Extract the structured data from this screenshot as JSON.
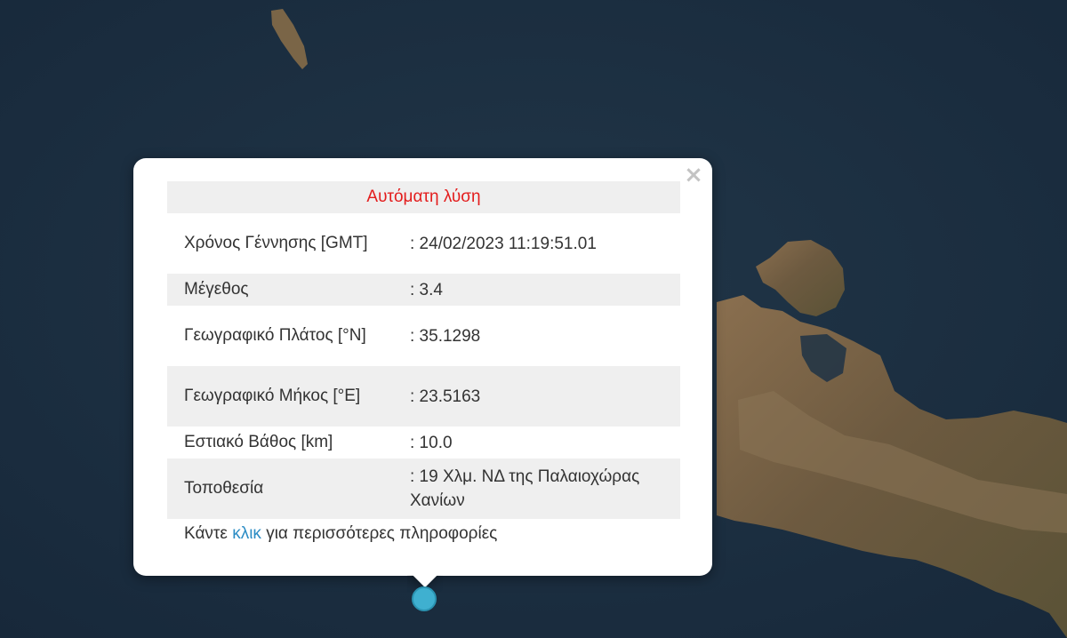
{
  "popup": {
    "title": "Αυτόματη λύση",
    "close_icon": "close-icon",
    "rows": [
      {
        "label": "Χρόνος Γέννησης [GMT]",
        "value": ": 24/02/2023 11:19:51.01"
      },
      {
        "label": "Μέγεθος",
        "value": ": 3.4"
      },
      {
        "label": "Γεωγραφικό Πλάτος [°N]",
        "value": ": 35.1298"
      },
      {
        "label": "Γεωγραφικό Μήκος [°E]",
        "value": ": 23.5163"
      },
      {
        "label": "Εστιακό Βάθος [km]",
        "value": ": 10.0"
      },
      {
        "label": "Τοποθεσία",
        "value": ": 19 Χλμ. ΝΔ της Παλαιοχώρας Χανίων"
      }
    ],
    "more_info": {
      "prefix": "Κάντε ",
      "link": "κλικ",
      "suffix": " για περισσότερες πληροφορίες"
    }
  },
  "map": {
    "basemap": "satellite",
    "sea_color": "#1c2e3f",
    "land_color": "#6e5a42",
    "marker_color": "#3fb0d0"
  }
}
